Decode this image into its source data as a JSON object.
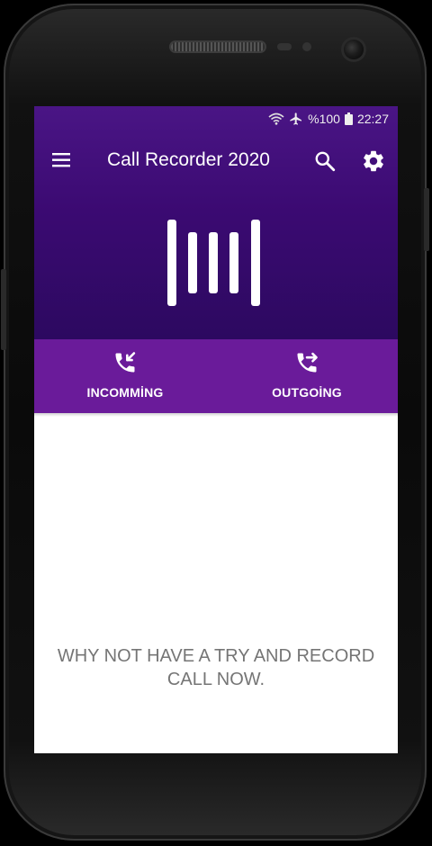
{
  "status_bar": {
    "battery": "%100",
    "time": "22:27",
    "icons": [
      "wifi-icon",
      "airplane-icon",
      "battery-icon"
    ]
  },
  "toolbar": {
    "title": "Call Recorder 2020",
    "icons": [
      "menu-icon",
      "search-icon",
      "settings-gear-icon"
    ]
  },
  "tabs": [
    {
      "label": "INCOMMİNG",
      "icon": "incoming-call-icon"
    },
    {
      "label": "OUTGOİNG",
      "icon": "outgoing-call-icon"
    }
  ],
  "empty_state": {
    "line1": "WHY NOT HAVE A TRY AND RECORD",
    "line2": "CALL NOW."
  },
  "colors": {
    "header_top": "#4a1585",
    "header_bottom": "#2c0960",
    "tab_bar": "#6a1b9a",
    "message_text": "#757575"
  }
}
